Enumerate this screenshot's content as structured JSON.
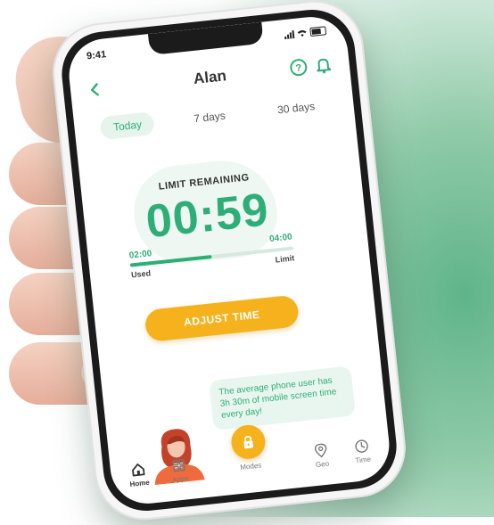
{
  "status": {
    "time": "9:41"
  },
  "header": {
    "title": "Alan",
    "back_icon": "chevron-left-icon",
    "help_icon": "help-circle-icon",
    "bell_icon": "bell-icon"
  },
  "tabs": [
    {
      "label": "Today",
      "active": true
    },
    {
      "label": "7 days",
      "active": false
    },
    {
      "label": "30 days",
      "active": false
    }
  ],
  "timer": {
    "heading": "LIMIT REMAINING",
    "value": "00:59",
    "used_value": "02:00",
    "used_label": "Used",
    "limit_value": "04:00",
    "limit_label": "Limit",
    "progress_fraction": 0.5
  },
  "adjust_button": {
    "label": "ADJUST TIME"
  },
  "tip": {
    "text": "The average phone user has 3h 30m of mobile screen time every day!"
  },
  "nav": [
    {
      "label": "Home",
      "icon": "home-icon",
      "active": true
    },
    {
      "label": "Apps",
      "icon": "apps-grid-icon",
      "active": false
    },
    {
      "label": "Modes",
      "icon": "lock-icon",
      "active": false
    },
    {
      "label": "Geo",
      "icon": "location-pin-icon",
      "active": false
    },
    {
      "label": "Time",
      "icon": "clock-icon",
      "active": false
    }
  ],
  "colors": {
    "accent_green": "#2eae77",
    "accent_yellow": "#f6b21c",
    "background_green": "#5fb489"
  }
}
